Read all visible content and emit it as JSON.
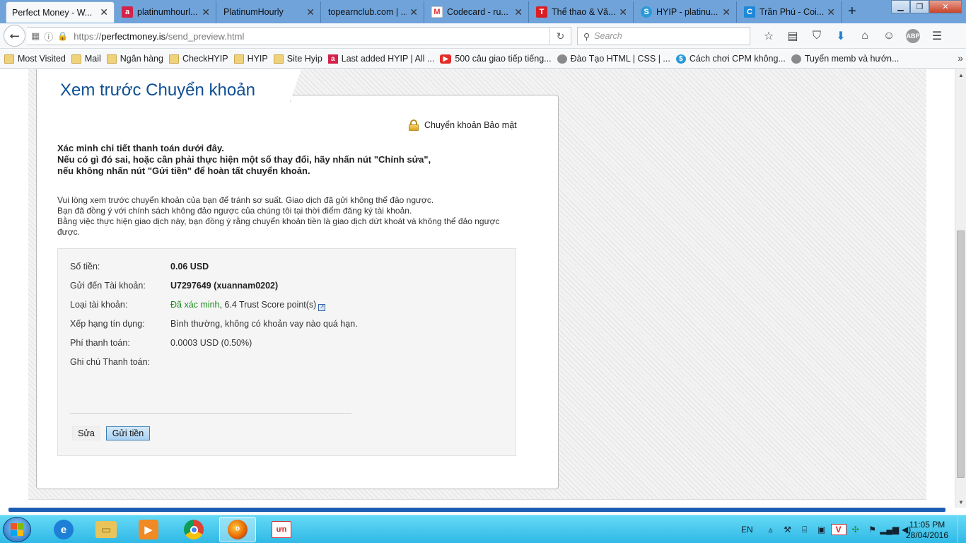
{
  "browser": {
    "tabs": [
      {
        "title": "Perfect Money - W...",
        "favicon": "perfect-money-icon",
        "active": true
      },
      {
        "title": "platinumhourl...",
        "favicon": "a-letter-icon",
        "active": false
      },
      {
        "title": "PlatinumHourly",
        "favicon": "",
        "active": false
      },
      {
        "title": "topearnclub.com | ...",
        "favicon": "",
        "active": false
      },
      {
        "title": "Codecard - ru...",
        "favicon": "gmail-icon",
        "active": false
      },
      {
        "title": "Thể thao & Vă...",
        "favicon": "t-letter-icon",
        "active": false
      },
      {
        "title": "HYIP - platinu...",
        "favicon": "skype-icon",
        "active": false
      },
      {
        "title": "Trần Phú - Coi...",
        "favicon": "c-letter-icon",
        "active": false
      }
    ],
    "new_tab": "+",
    "window_buttons": {
      "minimize": "▁",
      "maximize": "❐",
      "close": "✕"
    },
    "url": {
      "scheme": "https://",
      "host": "perfectmoney.is",
      "path": "/send_preview.html"
    },
    "search_placeholder": "Search",
    "bookmarks": [
      {
        "label": "Most Visited",
        "icon": "folder"
      },
      {
        "label": "Mail",
        "icon": "folder"
      },
      {
        "label": "Ngân hàng",
        "icon": "folder"
      },
      {
        "label": "CheckHYIP",
        "icon": "folder"
      },
      {
        "label": "HYIP",
        "icon": "folder"
      },
      {
        "label": "Site Hyip",
        "icon": "folder"
      },
      {
        "label": "Last added HYIP | All ...",
        "icon": "red"
      },
      {
        "label": "500 câu giao tiếp tiếng...",
        "icon": "yt"
      },
      {
        "label": "Đào Tạo HTML | CSS | ...",
        "icon": "globe"
      },
      {
        "label": "Cách chơi CPM không...",
        "icon": "cpm"
      },
      {
        "label": "Tuyển memb và hướn...",
        "icon": "globe"
      }
    ],
    "bookmarks_more": "»"
  },
  "page": {
    "title": "Xem trước Chuyển khoản",
    "secure_label": "Chuyển khoản Bảo mật",
    "verify_lines": [
      "Xác minh chi tiết thanh toán dưới đây.",
      "Nếu có gì đó sai, hoặc cần phải thực hiện một số thay đổi, hãy nhấn nút \"Chỉnh sửa\",",
      "nếu không nhấn nút \"Gửi tiền\" để hoàn tất chuyển khoản."
    ],
    "notice_lines": [
      "Vui lòng xem trước chuyển khoản của bạn để tránh sơ suất. Giao dịch đã gửi không thể đảo ngược.",
      "Bạn đã đồng ý với chính sách không đảo ngược của chúng tôi tại thời điểm đăng ký tài khoản.",
      "Bằng việc thực hiện giao dịch này, bạn đồng ý rằng chuyển khoản tiền là giao dịch dứt khoát và không thể đảo ngược được."
    ],
    "details": {
      "amount_label": "Số tiền:",
      "amount_value": "0.06 USD",
      "to_label": "Gửi đến Tài khoản:",
      "to_value": "U7297649 (xuannam0202)",
      "type_label": "Loại tài khoản:",
      "type_verified": "Đã xác minh",
      "type_rest": ", 6.4 Trust Score point(s)",
      "credit_label": "Xếp hạng tín dụng:",
      "credit_value": "Bình thường, không có khoản vay nào quá hạn.",
      "fee_label": "Phí thanh toán:",
      "fee_value": "0.0003 USD (0.50%)",
      "memo_label": "Ghi chú Thanh toán:",
      "memo_value": ""
    },
    "buttons": {
      "edit": "Sửa",
      "send": "Gửi tiền"
    }
  },
  "taskbar": {
    "language": "EN",
    "time": "11:05 PM",
    "date": "28/04/2016"
  }
}
